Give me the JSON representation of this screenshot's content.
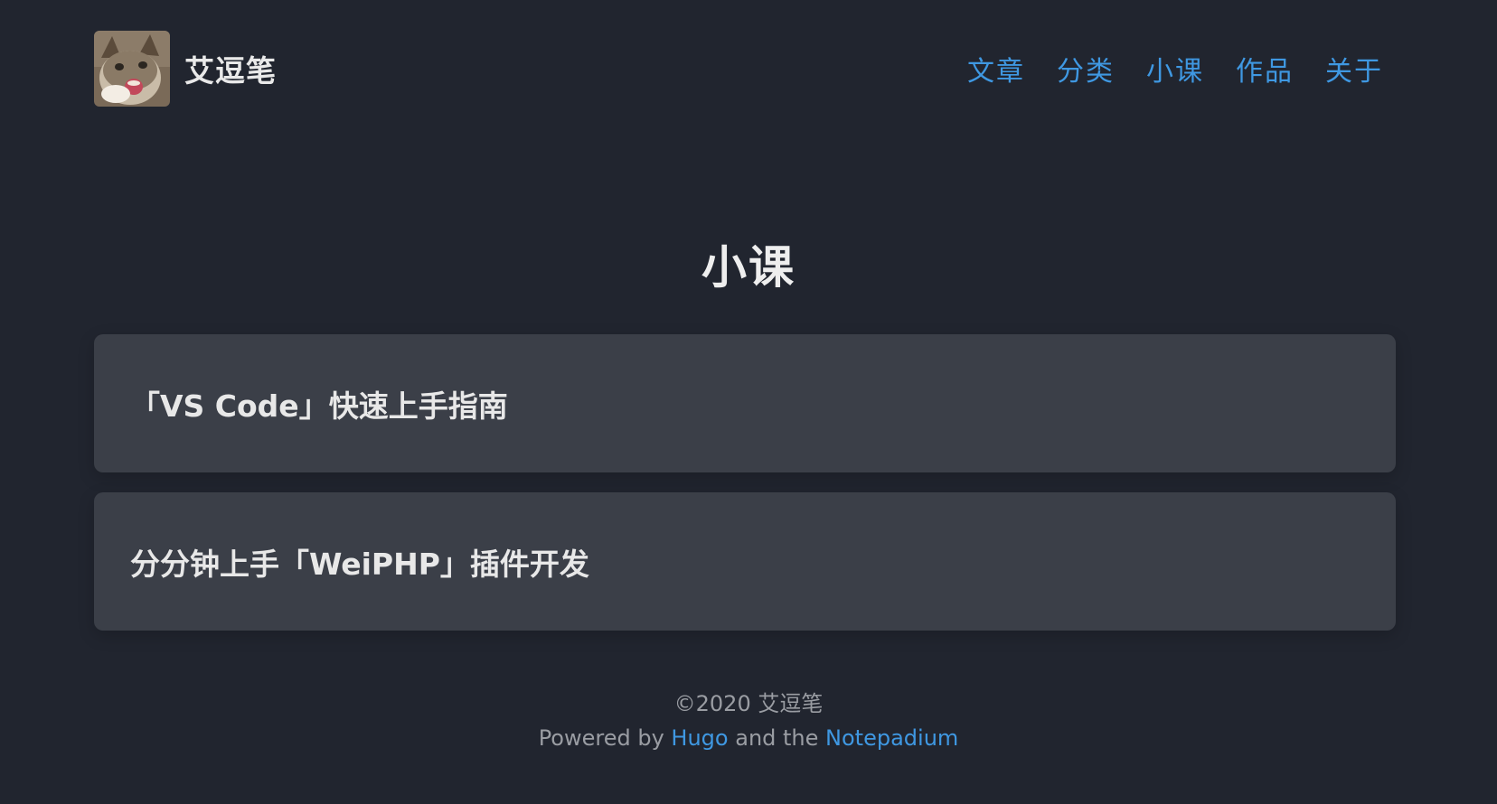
{
  "header": {
    "site_title": "艾逗笔",
    "avatar_icon": "cat-avatar-icon",
    "nav": [
      {
        "label": "文章"
      },
      {
        "label": "分类"
      },
      {
        "label": "小课"
      },
      {
        "label": "作品"
      },
      {
        "label": "关于"
      }
    ]
  },
  "main": {
    "page_title": "小课",
    "courses": [
      {
        "title": "「VS Code」快速上手指南"
      },
      {
        "title": "分分钟上手「WeiPHP」插件开发"
      }
    ]
  },
  "footer": {
    "copyright": "©2020 艾逗笔",
    "powered_prefix": "Powered by ",
    "hugo_link": "Hugo",
    "and_the": " and the ",
    "theme_link": "Notepadium"
  },
  "colors": {
    "background": "#21252f",
    "card": "#3b3f48",
    "accent": "#3f98e2",
    "muted": "#9a9da3"
  }
}
